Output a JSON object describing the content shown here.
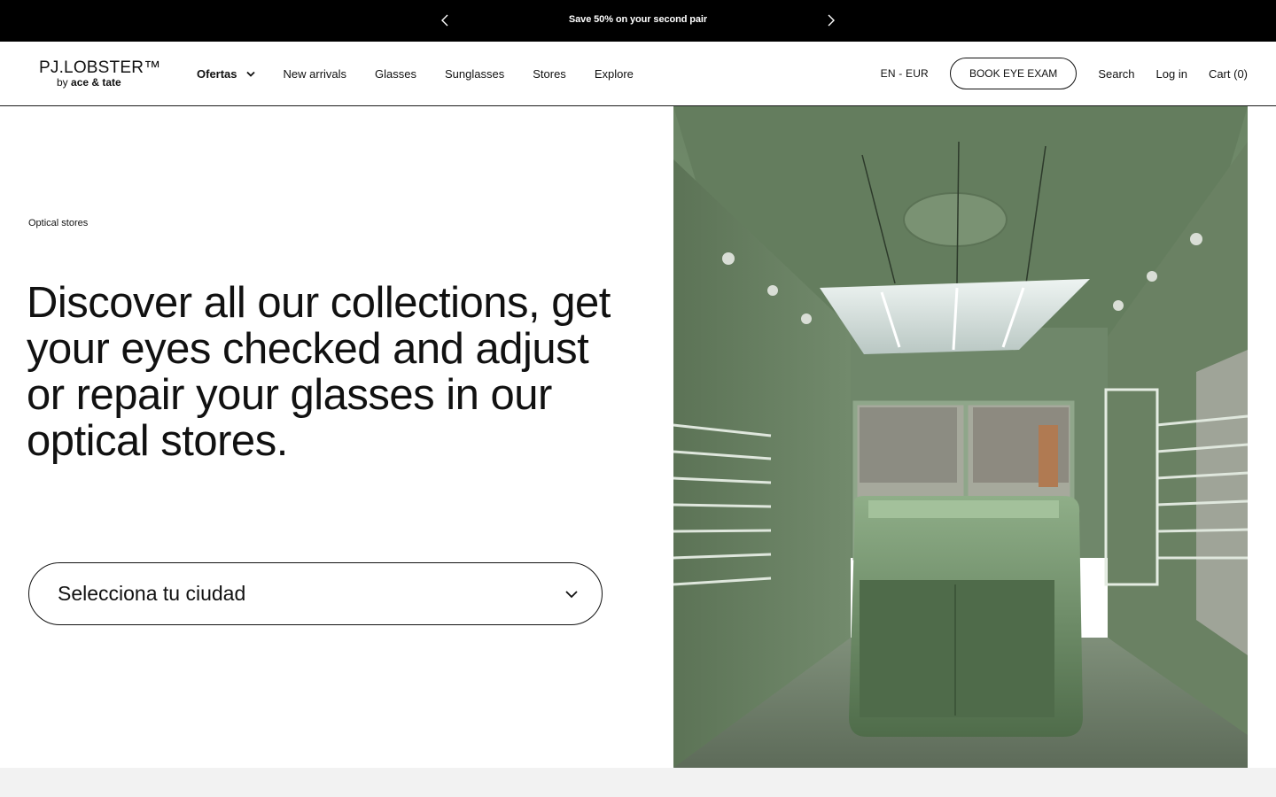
{
  "announcement": {
    "message": "Save 50% on your second pair",
    "prev_icon": "chevron-left-icon",
    "next_icon": "chevron-right-icon"
  },
  "header": {
    "logo": {
      "brand": "PJ.LOBSTER™",
      "by": "by",
      "partner": "ace & tate"
    },
    "nav": [
      {
        "label": "Ofertas",
        "has_dropdown": true
      },
      {
        "label": "New arrivals"
      },
      {
        "label": "Glasses"
      },
      {
        "label": "Sunglasses"
      },
      {
        "label": "Stores"
      },
      {
        "label": "Explore"
      }
    ],
    "language": "EN - EUR",
    "book_button": "BOOK EYE EXAM",
    "search": "Search",
    "login": "Log in",
    "cart": "Cart (0)"
  },
  "hero": {
    "eyebrow": "Optical stores",
    "headline": "Discover all our collections, get your eyes checked and adjust or repair your glasses in our optical stores.",
    "city_select": {
      "value": "Selecciona tu ciudad",
      "icon": "chevron-down-icon"
    },
    "image_icon": "store-interior-photo"
  },
  "colors": {
    "announcement_bg": "#000000",
    "text": "#111111",
    "store_green": "#6f8a6a",
    "footer_strip": "#f2f2f2"
  }
}
